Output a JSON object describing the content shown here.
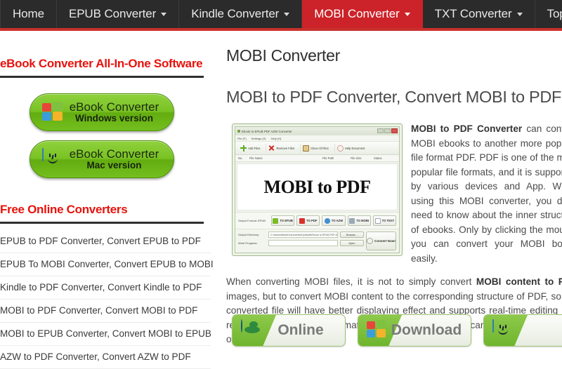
{
  "nav": {
    "items": [
      {
        "label": "Home",
        "has_caret": false,
        "active": false
      },
      {
        "label": "EPUB Converter",
        "has_caret": true,
        "active": false
      },
      {
        "label": "Kindle Converter",
        "has_caret": true,
        "active": false
      },
      {
        "label": "MOBI Converter",
        "has_caret": true,
        "active": true
      },
      {
        "label": "TXT Converter",
        "has_caret": true,
        "active": false
      },
      {
        "label": "Top Softwares",
        "has_caret": false,
        "active": false
      }
    ],
    "bar_color": "#2b2b2b",
    "accent_color": "#c9302c",
    "active_color": "#cc2229"
  },
  "sidebar": {
    "heading_software": "eBook Converter All-In-One Software",
    "heading_online": "Free Online Converters",
    "heading_color": "#e8120c",
    "download_buttons": [
      {
        "icon": "windows-flag-icon",
        "line1": "eBook Converter",
        "line2": "Windows version"
      },
      {
        "icon": "mac-finder-icon",
        "line1": "eBook Converter",
        "line2": "Mac version"
      }
    ],
    "links": [
      "EPUB to PDF Converter, Convert EPUB to PDF",
      "EPUB To MOBI Converter, Convert EPUB to MOBI",
      "Kindle to PDF Converter, Convert Kindle to PDF",
      "MOBI to PDF Converter, Convert MOBI to PDF",
      "MOBI to EPUB Converter, Convert MOBI to EPUB",
      "AZW to PDF Converter, Convert AZW to PDF"
    ]
  },
  "main": {
    "page_title": "MOBI Converter",
    "article_title": "MOBI to PDF Converter, Convert MOBI to PDF",
    "paragraph1_lead": "MOBI to PDF Converter",
    "paragraph1_rest": " can convert MOBI ebooks to another more popular file format PDF. PDF is one of the most popular file formats, and it is supported by various devices and App. When using this MOBI converter, you don't need to know about the inner structure of ebooks. Only by clicking the mouse, you can convert your MOBI books easily.",
    "paragraph2_pre": "When converting MOBI files, it is not to simply convert ",
    "paragraph2_bold": "MOBI content to PDF",
    "paragraph2_rest": " images, but to convert MOBI content to the corresponding structure of PDF, so the converted file will have better displaying effect and supports real-time editing and retrieval. After the MOBI format is converted to PDF, you can transfer the ebook to other device to read.",
    "big_buttons": [
      {
        "icon": "globe-icon",
        "label": "Online"
      },
      {
        "icon": "windows-flag-icon",
        "label": "Download"
      },
      {
        "icon": "mac-finder-icon",
        "label": ""
      }
    ]
  },
  "app_screenshot": {
    "window_title": "Ebook to EPUB PDF AZW Converter",
    "menu": [
      "File (F)",
      "Settings (S)",
      "Help (H)"
    ],
    "toolbar": [
      {
        "icon": "plus-icon",
        "label": "Add Files"
      },
      {
        "icon": "remove-x-icon",
        "label": "Remove Files"
      },
      {
        "icon": "clear-sheet-icon",
        "label": "Clear All Files"
      },
      {
        "icon": "help-circle-icon",
        "label": "Help Document"
      }
    ],
    "columns": [
      "No.",
      "File Name",
      "File Path",
      "File Size",
      "Status"
    ],
    "watermark": "MOBI to PDF",
    "output_format_label": "Output Format: EPUB",
    "format_buttons": [
      {
        "icon": "epub-icon",
        "label": "TO EPUB"
      },
      {
        "icon": "pdf-icon",
        "label": "TO PDF"
      },
      {
        "icon": "azw-icon",
        "label": "TO AZW"
      },
      {
        "icon": "mobi-icon",
        "label": "TO MOBI"
      },
      {
        "icon": "txt-icon",
        "label": "TO TEXT"
      }
    ],
    "output_directory_label": "Output Directory:",
    "output_directory_value": "C:\\Users\\Alkar\\Documents\\Epubsoft\\Ebook to EPUB PDF A",
    "browse_label": "Browse...",
    "work_progress_label": "Work Progress:",
    "open_label": "Open",
    "convert_label": "Convert Now!"
  }
}
